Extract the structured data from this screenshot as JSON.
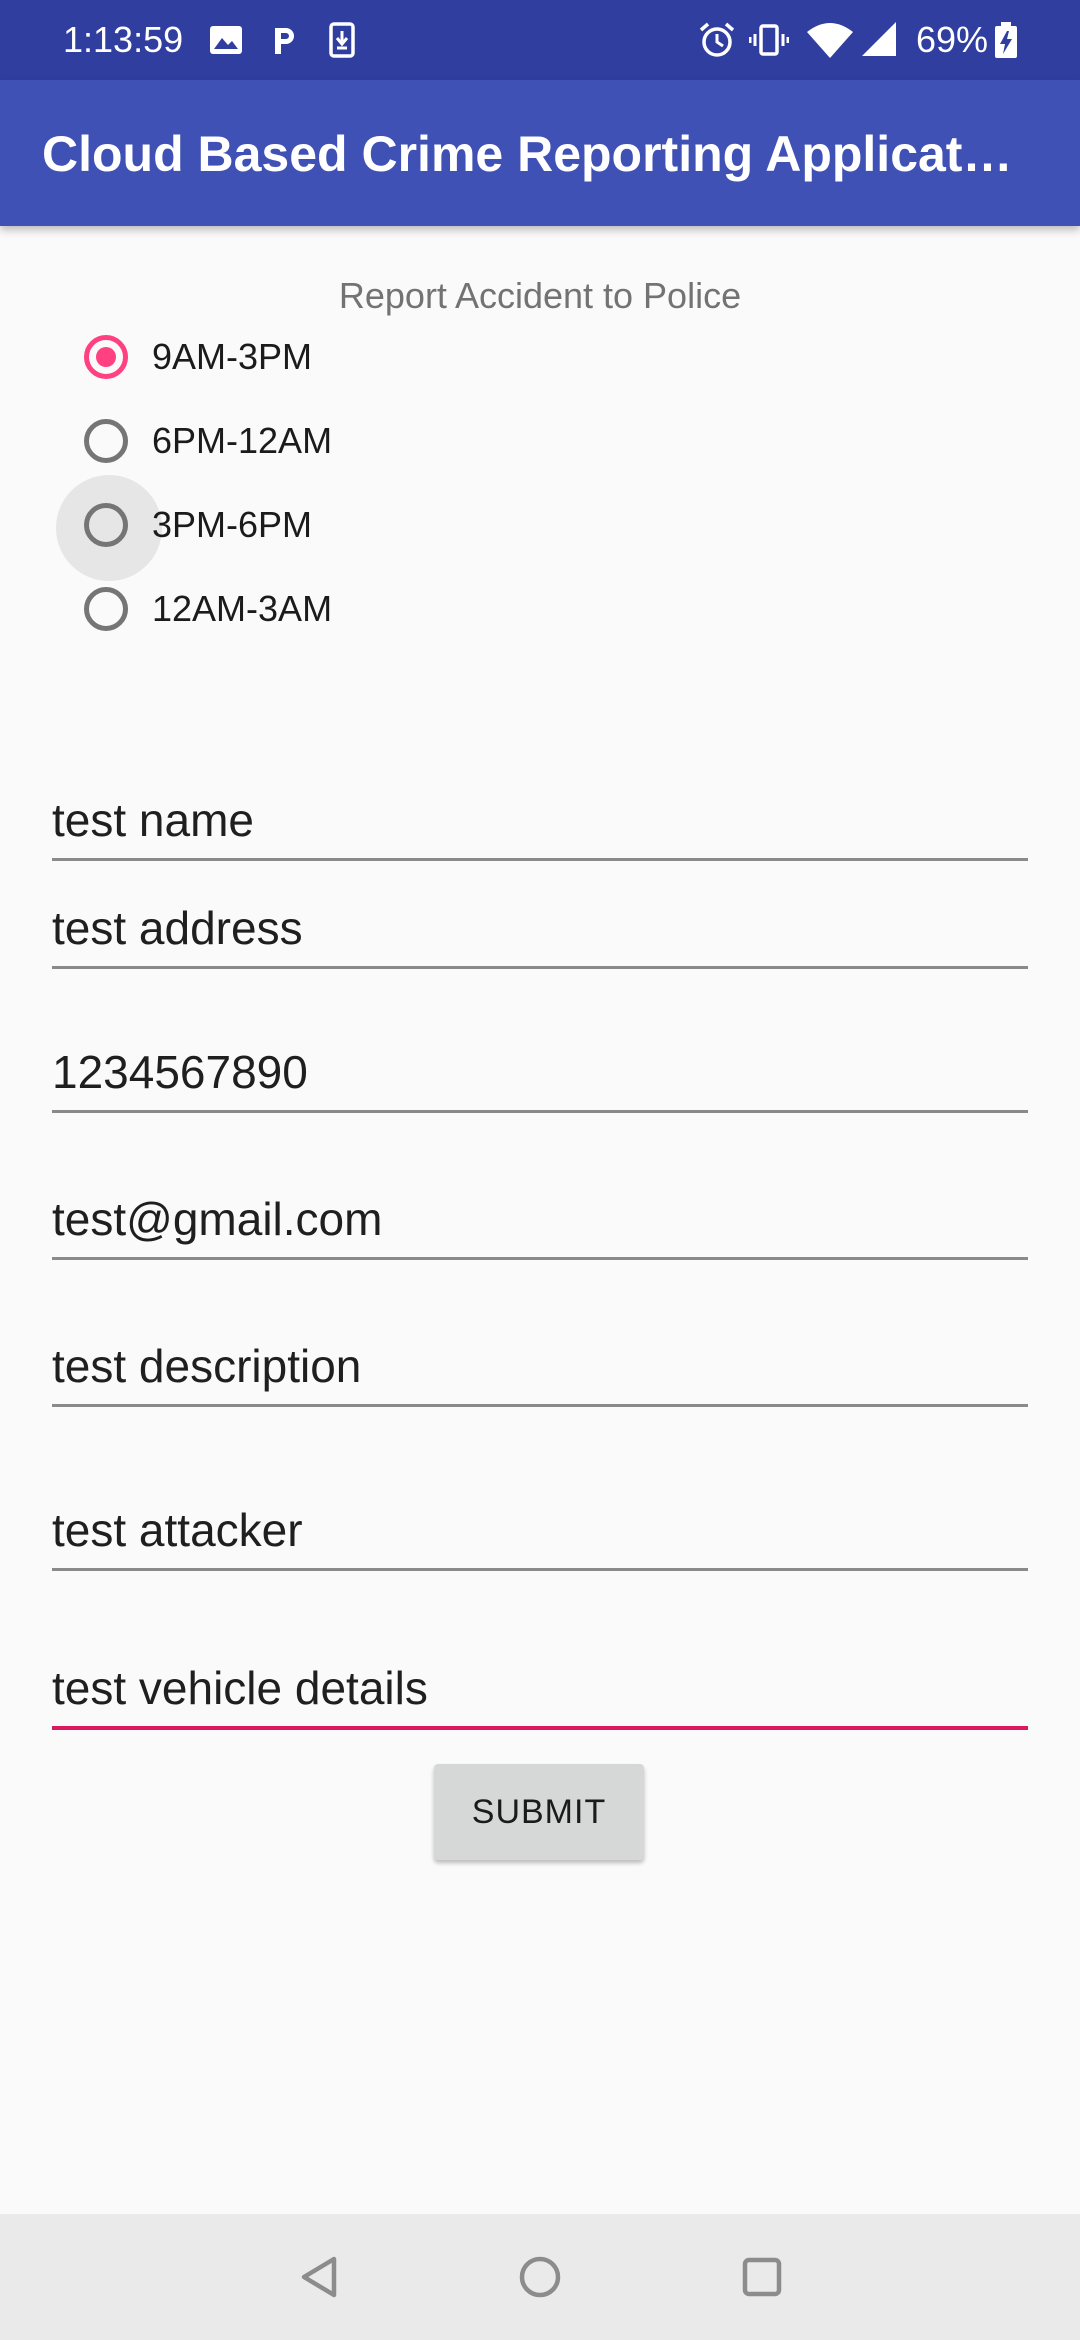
{
  "status_bar": {
    "time": "1:13:59",
    "battery": "69%",
    "left_icons": [
      "image-icon",
      "parking-icon",
      "download-icon"
    ],
    "right_icons": [
      "alarm-icon",
      "vibrate-icon",
      "wifi-icon",
      "signal-icon",
      "battery-charging-icon"
    ]
  },
  "app_bar": {
    "title": "Cloud Based Crime Reporting Application",
    "color": "#3f51b5",
    "status_color": "#303f9f"
  },
  "form": {
    "heading": "Report Accident to Police",
    "time_options": [
      {
        "label": "9AM-3PM",
        "checked": true
      },
      {
        "label": "6PM-12AM",
        "checked": false
      },
      {
        "label": "3PM-6PM",
        "checked": false,
        "pressed": true
      },
      {
        "label": "12AM-3AM",
        "checked": false
      }
    ],
    "fields": [
      {
        "name": "name",
        "value": "test name"
      },
      {
        "name": "address",
        "value": "test address"
      },
      {
        "name": "phone",
        "value": "1234567890"
      },
      {
        "name": "email",
        "value": "test@gmail.com"
      },
      {
        "name": "description",
        "value": "test description"
      },
      {
        "name": "attacker",
        "value": "test attacker"
      },
      {
        "name": "vehicle-details",
        "value": "test vehicle details",
        "focused": true
      }
    ],
    "submit_label": "SUBMIT",
    "accent_color": "#ff4081"
  },
  "nav_bar": {
    "buttons": [
      "back-icon",
      "home-icon",
      "recents-icon"
    ]
  }
}
